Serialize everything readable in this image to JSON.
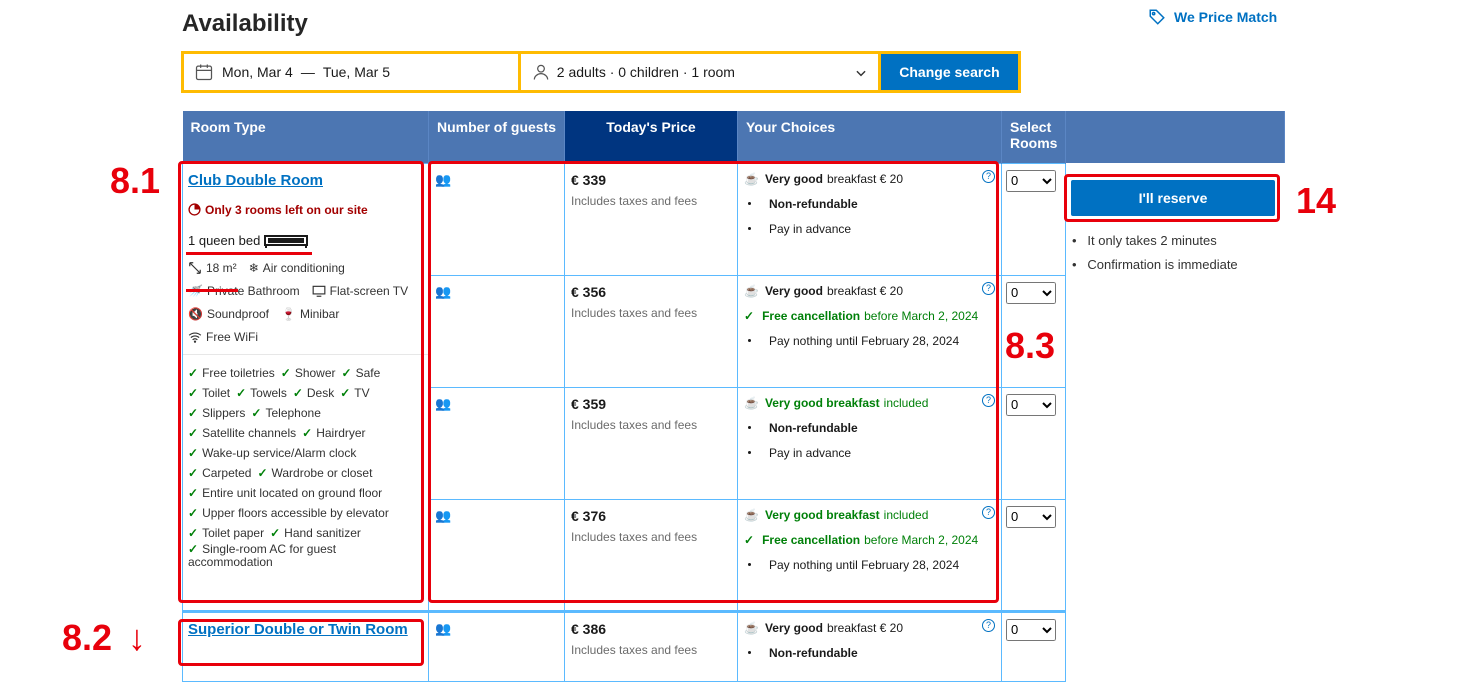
{
  "header": {
    "title": "Availability",
    "price_match": "We Price Match"
  },
  "search": {
    "date_from": "Mon, Mar 4",
    "date_sep": "—",
    "date_to": "Tue, Mar 5",
    "guests": "2 adults · 0 children · 1 room",
    "button": "Change search"
  },
  "table": {
    "headers": [
      "Room Type",
      "Number of guests",
      "Today's Price",
      "Your Choices",
      "Select Rooms"
    ]
  },
  "room1": {
    "name": "Club Double Room",
    "scarcity": "Only 3 rooms left on our site",
    "bed": "1 queen bed",
    "size": "18 m²",
    "facilities": [
      "Air conditioning",
      "Private Bathroom",
      "Flat-screen TV",
      "Soundproof",
      "Minibar",
      "Free WiFi"
    ],
    "amenities": [
      [
        "Free toiletries",
        "Shower",
        "Safe"
      ],
      [
        "Toilet",
        "Towels",
        "Desk",
        "TV"
      ],
      [
        "Slippers",
        "Telephone"
      ],
      [
        "Satellite channels",
        "Hairdryer"
      ],
      [
        "Wake-up service/Alarm clock"
      ],
      [
        "Carpeted",
        "Wardrobe or closet"
      ],
      [
        "Entire unit located on ground floor"
      ],
      [
        "Upper floors accessible by elevator"
      ],
      [
        "Toilet paper",
        "Hand sanitizer"
      ],
      [
        "Single-room AC for guest accommodation"
      ]
    ]
  },
  "room2": {
    "name": "Superior Double or Twin Room"
  },
  "offers": [
    {
      "price": "€ 339",
      "taxes": "Includes taxes and fees",
      "bf_strong": "Very good",
      "bf_rest": "breakfast € 20",
      "bf_included": false,
      "c1": "Non-refundable",
      "c1_strong": true,
      "c1_green": false,
      "c2": "Pay in advance",
      "select": "0"
    },
    {
      "price": "€ 356",
      "taxes": "Includes taxes and fees",
      "bf_strong": "Very good",
      "bf_rest": "breakfast € 20",
      "bf_included": false,
      "c1": "Free cancellation",
      "c1_rest": "before March 2, 2024",
      "c1_green": true,
      "c2": "Pay nothing until February 28, 2024",
      "select": "0"
    },
    {
      "price": "€ 359",
      "taxes": "Includes taxes and fees",
      "bf_strong": "Very good breakfast",
      "bf_rest": "included",
      "bf_included": true,
      "c1": "Non-refundable",
      "c1_strong": true,
      "c1_green": false,
      "c2": "Pay in advance",
      "select": "0"
    },
    {
      "price": "€ 376",
      "taxes": "Includes taxes and fees",
      "bf_strong": "Very good breakfast",
      "bf_rest": "included",
      "bf_included": true,
      "c1": "Free cancellation",
      "c1_rest": "before March 2, 2024",
      "c1_green": true,
      "c2": "Pay nothing until February 28, 2024",
      "select": "0"
    },
    {
      "price": "€ 386",
      "taxes": "Includes taxes and fees",
      "bf_strong": "Very good",
      "bf_rest": "breakfast € 20",
      "bf_included": false,
      "c1": "Non-refundable",
      "c1_strong": true,
      "c1_green": false,
      "c2": "",
      "select": "0"
    }
  ],
  "reserve": {
    "button": "I'll reserve",
    "notes": [
      "It only takes 2 minutes",
      "Confirmation is immediate"
    ]
  },
  "annotations": {
    "a81": "8.1",
    "a82": "8.2",
    "a83": "8.3",
    "a14": "14",
    "arrow": "↓",
    "color": "#e8000b"
  },
  "colors": {
    "header_blue": "#4c76b2",
    "today_blue": "#003580",
    "link_blue": "#0071c2",
    "green": "#008009",
    "yellow": "#febb02"
  }
}
